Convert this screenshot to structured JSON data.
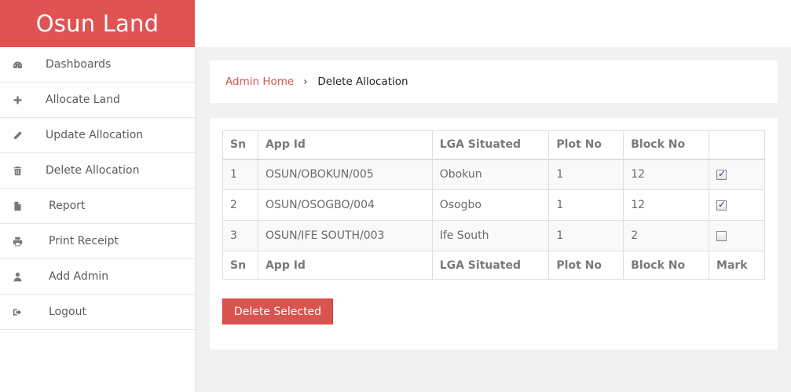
{
  "brand": {
    "title": "Osun Land",
    "color": "#e05353"
  },
  "sidebar": {
    "items": [
      {
        "label": "Dashboards",
        "icon": "dashboard-icon"
      },
      {
        "label": "Allocate Land",
        "icon": "plus-icon"
      },
      {
        "label": "Update Allocation",
        "icon": "pencil-icon"
      },
      {
        "label": "Delete Allocation",
        "icon": "trash-icon"
      },
      {
        "label": "Report",
        "icon": "file-icon"
      },
      {
        "label": "Print Receipt",
        "icon": "print-icon"
      },
      {
        "label": "Add Admin",
        "icon": "user-icon"
      },
      {
        "label": "Logout",
        "icon": "logout-icon"
      }
    ]
  },
  "breadcrumb": {
    "home": "Admin Home",
    "separator": "›",
    "current": "Delete Allocation"
  },
  "table": {
    "headers": [
      "Sn",
      "App Id",
      "LGA Situated",
      "Plot No",
      "Block No",
      ""
    ],
    "footer": [
      "Sn",
      "App Id",
      "LGA Situated",
      "Plot No",
      "Block No",
      "Mark"
    ],
    "rows": [
      {
        "sn": "1",
        "app_id": "OSUN/OBOKUN/005",
        "lga": "Obokun",
        "plot": "1",
        "block": "12",
        "marked": true
      },
      {
        "sn": "2",
        "app_id": "OSUN/OSOGBO/004",
        "lga": "Osogbo",
        "plot": "1",
        "block": "12",
        "marked": true
      },
      {
        "sn": "3",
        "app_id": "OSUN/IFE SOUTH/003",
        "lga": "Ife South",
        "plot": "1",
        "block": "2",
        "marked": false
      }
    ]
  },
  "actions": {
    "delete_label": "Delete Selected",
    "color": "#d9534f"
  }
}
